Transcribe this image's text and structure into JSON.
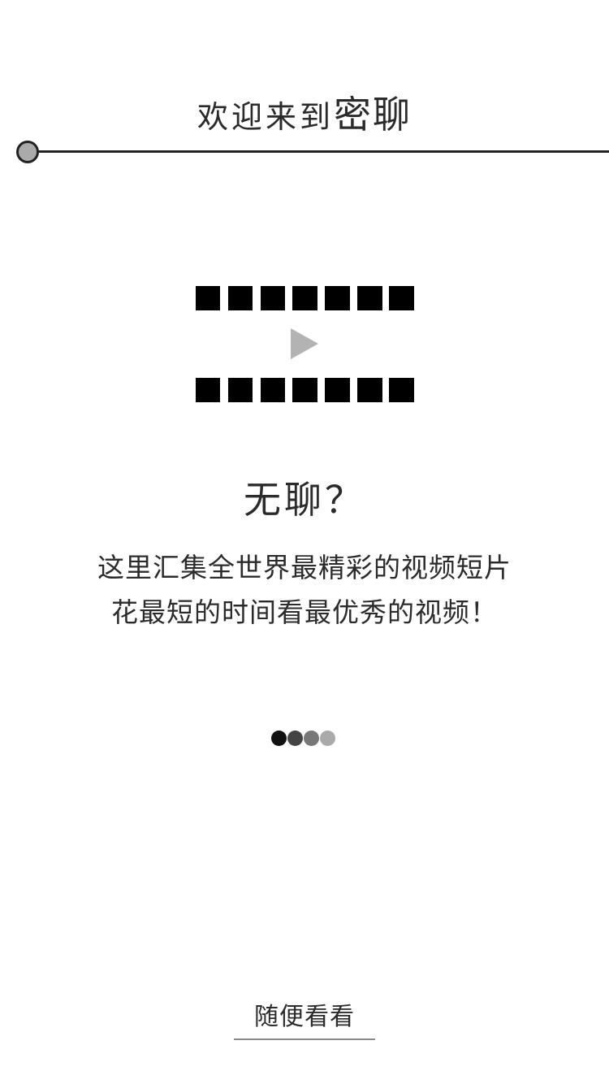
{
  "header": {
    "welcome_text": "欢迎来到",
    "brand_name": "密聊"
  },
  "intro": {
    "headline": "无聊？",
    "tagline_line1": "这里汇集全世界最精彩的视频短片",
    "tagline_line2": "花最短的时间看最优秀的视频！"
  },
  "pager": {
    "page_count": 4,
    "dot_colors": [
      "#111111",
      "#444444",
      "#777777",
      "#aaaaaa"
    ]
  },
  "actions": {
    "browse_label": "随便看看"
  },
  "icons": {
    "header_rule": "circle-line-icon",
    "video": "film-strip-play-icon"
  },
  "colors": {
    "text": "#2b2b2b",
    "film_blocks": "#000000",
    "play_triangle": "#b3b3b3",
    "underline": "#8a8a8a"
  }
}
